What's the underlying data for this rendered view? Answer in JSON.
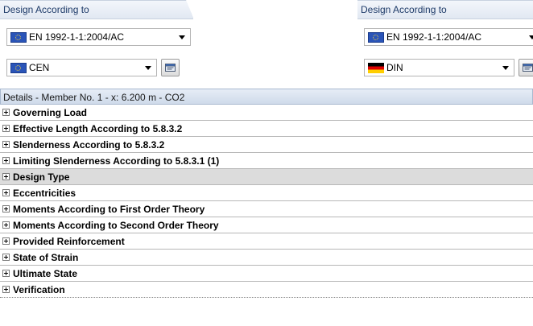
{
  "left_panel": {
    "title": "Design According to",
    "standard": {
      "value": "EN 1992-1-1:2004/AC",
      "flag": "eu-flag-icon"
    },
    "annex": {
      "value": "CEN",
      "flag": "eu-flag-icon"
    }
  },
  "right_panel": {
    "title": "Design According to",
    "standard": {
      "value": "EN 1992-1-1:2004/AC",
      "flag": "eu-flag-icon"
    },
    "annex": {
      "value": "DIN",
      "flag": "germany-flag-icon"
    }
  },
  "details": {
    "header": "Details  -  Member No. 1  -  x: 6.200 m  -  CO2",
    "items": [
      {
        "label": "Governing Load"
      },
      {
        "label": "Effective Length According to 5.8.3.2"
      },
      {
        "label": "Slenderness According to 5.8.3.2"
      },
      {
        "label": "Limiting Slenderness According to 5.8.3.1 (1)"
      },
      {
        "label": "Design Type"
      },
      {
        "label": "Eccentricities"
      },
      {
        "label": "Moments According to First Order Theory"
      },
      {
        "label": "Moments According to Second Order Theory"
      },
      {
        "label": "Provided Reinforcement"
      },
      {
        "label": "State of Strain"
      },
      {
        "label": "Ultimate State"
      },
      {
        "label": "Verification"
      }
    ]
  },
  "colors": {
    "panel_header_text": "#1d3a68",
    "details_header_bg": "#cfdbea",
    "row_shaded_bg": "#dcdcdc"
  }
}
